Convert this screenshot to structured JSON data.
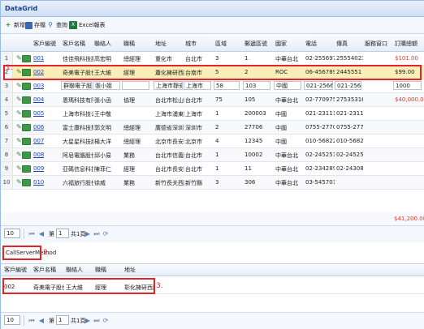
{
  "title": "DataGrid",
  "toolbar": {
    "add": "新增",
    "save": "存檔",
    "search": "查詢",
    "excel": "Excel報表"
  },
  "columns": [
    "客戶編號",
    "客戶名稱",
    "聯絡人",
    "職稱",
    "地址",
    "城市",
    "區域",
    "郵遞區號",
    "國家",
    "電話",
    "傳真",
    "服務窗口",
    "訂購總額"
  ],
  "rows": [
    {
      "num": "1",
      "id": "001",
      "name": "佳佳飛科技股份",
      "contact": "高宏明",
      "title": "總經理",
      "addr": "重化市",
      "city": "台北市",
      "region": "3",
      "zip": "1",
      "country": "中華台北",
      "phone": "02-25569720",
      "fax": "25554023",
      "total": "$101.00",
      "total_red": true
    },
    {
      "num": "2",
      "id": "002",
      "name": "奇美電子股份",
      "contact": "王大維",
      "title": "經理",
      "addr": "蕭化擁研西路",
      "city": "台南市",
      "region": "5",
      "zip": "2",
      "country": "ROC",
      "phone": "06-4567899",
      "fax": "2445551",
      "total": "$99.00",
      "total_red": false
    },
    {
      "num": "3",
      "id": "003",
      "name": "群聯電子股份",
      "contact": "張小姐",
      "title": "",
      "addr": "上海市靜安區",
      "city": "上海市",
      "region": "58",
      "zip": "103",
      "country": "中國",
      "phone": "021-2566800",
      "fax": "021-2566800",
      "total": "1000",
      "total_red": false
    },
    {
      "num": "4",
      "id": "004",
      "name": "恩瑪科技有限公",
      "contact": "張小函",
      "title": "協理",
      "addr": "台北市松山區",
      "city": "台北市",
      "region": "75",
      "zip": "105",
      "country": "中華台北",
      "phone": "02-77097530",
      "fax": "27535316",
      "total": "$40,000.00",
      "total_red": true
    },
    {
      "num": "5",
      "id": "005",
      "name": "上海市科技公",
      "contact": "王中敬",
      "title": "",
      "addr": "上海市浦東區",
      "city": "上海市",
      "region": "1",
      "zip": "200003",
      "country": "中國",
      "phone": "021-23111111",
      "fax": "021-23111111",
      "total": "",
      "total_red": false
    },
    {
      "num": "6",
      "id": "006",
      "name": "富士康科技集",
      "contact": "郭文明",
      "title": "總經理",
      "addr": "廣德省深圳市",
      "city": "深圳市",
      "region": "2",
      "zip": "27706",
      "country": "中國",
      "phone": "0755-27706888",
      "fax": "0755-27706666",
      "total": "",
      "total_red": false
    },
    {
      "num": "7",
      "id": "007",
      "name": "大星星科技股份",
      "contact": "楊大洋",
      "title": "總經理",
      "addr": "北京市長安西路",
      "city": "北京市",
      "region": "4",
      "zip": "12345",
      "country": "中國",
      "phone": "010-56822332",
      "fax": "010-56822333",
      "total": "",
      "total_red": false
    },
    {
      "num": "8",
      "id": "008",
      "name": "阿皂電腦股份",
      "contact": "邱小易",
      "title": "業務",
      "addr": "台北市信義區",
      "city": "台北市",
      "region": "1",
      "zip": "10002",
      "country": "中華台北",
      "phone": "02-24525155",
      "fax": "02-24525717",
      "total": "",
      "total_red": false
    },
    {
      "num": "9",
      "id": "009",
      "name": "亞碼信息科技",
      "contact": "陳菲仁",
      "title": "經理",
      "addr": "台北市長安西",
      "city": "台北市",
      "region": "1",
      "zip": "11",
      "country": "中華台北",
      "phone": "02-23428985",
      "fax": "02-24308985",
      "total": "",
      "total_red": false
    },
    {
      "num": "10",
      "id": "010",
      "name": "六福旅行股份",
      "contact": "徐威",
      "title": "業務",
      "addr": "新竹長夫西路",
      "city": "新竹縣",
      "region": "3",
      "zip": "306",
      "country": "中華台北",
      "phone": "03-54570120",
      "fax": "",
      "total": "",
      "total_red": false
    }
  ],
  "grand_total": "$41,200.00",
  "pager": {
    "page_size": "10",
    "page_label": "第",
    "page": "1",
    "of_label": "共1頁"
  },
  "csm_button": "CallServerMethod",
  "annotations": {
    "a1": "1.",
    "a2": "2.",
    "a3": "3."
  },
  "grid2": {
    "columns": [
      "客戶編號",
      "客戶名稱",
      "聯絡人",
      "職稱",
      "地址"
    ],
    "row": {
      "id": "002",
      "name": "奇美電子股份",
      "contact": "王大維",
      "title": "經理",
      "addr": "彰化擁研西路"
    }
  },
  "pager2": {
    "page_size": "10",
    "page_label": "第",
    "page": "1",
    "of_label": "共1頁"
  }
}
